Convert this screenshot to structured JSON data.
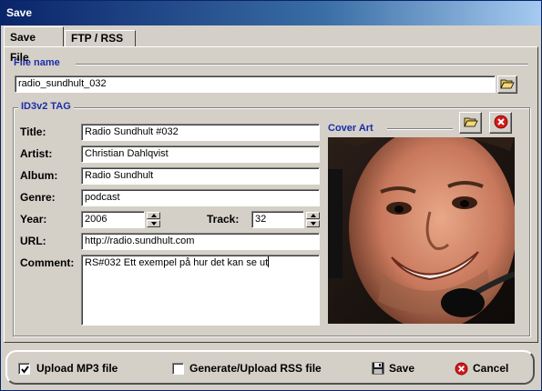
{
  "window": {
    "title": "Save"
  },
  "tabs": [
    {
      "label": "Save File",
      "active": true
    },
    {
      "label": "FTP / RSS",
      "active": false
    }
  ],
  "file": {
    "section_label": "File name",
    "value": "radio_sundhult_032",
    "browse_icon": "folder-open-icon"
  },
  "id3": {
    "section_label": "ID3v2 TAG",
    "labels": {
      "title": "Title:",
      "artist": "Artist:",
      "album": "Album:",
      "genre": "Genre:",
      "year": "Year:",
      "track": "Track:",
      "url": "URL:",
      "comment": "Comment:"
    },
    "values": {
      "title": "Radio Sundhult #032",
      "artist": "Christian Dahlqvist",
      "album": "Radio Sundhult",
      "genre": "podcast",
      "year": "2006",
      "track": "32",
      "url": "http://radio.sundhult.com",
      "comment": "RS#032 Ett exempel på hur det kan se ut"
    }
  },
  "cover": {
    "label": "Cover Art",
    "open_icon": "folder-open-icon",
    "remove_icon": "red-x-icon"
  },
  "bottom": {
    "upload_mp3": {
      "label": "Upload MP3 file",
      "checked": true
    },
    "upload_rss": {
      "label": "Generate/Upload RSS file",
      "checked": false
    },
    "save_label": "Save",
    "cancel_label": "Cancel"
  },
  "colors": {
    "section_label": "#1a2ea8",
    "titlebar_start": "#0a246a",
    "face": "#d4d0c8"
  }
}
